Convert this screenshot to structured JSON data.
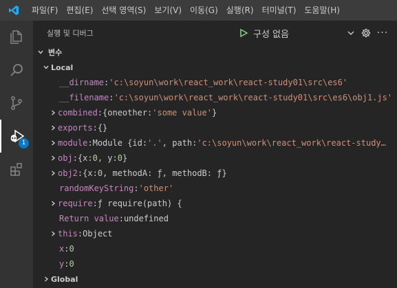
{
  "menu": [
    "파일(F)",
    "편집(E)",
    "선택 영역(S)",
    "보기(V)",
    "이동(G)",
    "실행(R)",
    "터미널(T)",
    "도움말(H)"
  ],
  "activity_badge": "1",
  "sidebar": {
    "title": "실행 및 디버그",
    "config_label": "구성 없음",
    "more_label": "···",
    "section_title": "변수"
  },
  "variables": {
    "local_scope": "Local",
    "global_scope": "Global",
    "dirname": {
      "name": "__dirname",
      "value": "'c:\\soyun\\work\\react_work\\react-study01\\src\\es6'"
    },
    "filename": {
      "name": "__filename",
      "value": "'c:\\soyun\\work\\react_work\\react-study01\\src\\es6\\obj1.js'"
    },
    "combined": {
      "name": "combined",
      "value_a": "{oneother: ",
      "value_b": "'some value'",
      "value_c": "}"
    },
    "exports": {
      "name": "exports",
      "value": "{}"
    },
    "module": {
      "name": "module",
      "value_a": "Module {id: ",
      "value_b": "'.'",
      "value_c": ", path: ",
      "value_d": "'c:\\soyun\\work\\react_work\\react-study…"
    },
    "obj": {
      "name": "obj",
      "value_a": "{x: ",
      "value_b": "0",
      "value_c": ", y: ",
      "value_d": "0",
      "value_e": "}"
    },
    "obj2": {
      "name": "obj2",
      "value_a": "{x: ",
      "value_b": "0",
      "value_c": ", methodA: ƒ, methodB: ƒ}"
    },
    "randomKeyString": {
      "name": "randomKeyString",
      "value": "'other'"
    },
    "require": {
      "name": "require",
      "value": "ƒ require(path) {"
    },
    "return_value": {
      "name": "Return value",
      "value": "undefined"
    },
    "this": {
      "name": "this",
      "value": "Object"
    },
    "x": {
      "name": "x",
      "value": "0"
    },
    "y": {
      "name": "y",
      "value": "0"
    },
    "separator": ": "
  },
  "colors": {
    "accent": "#007acc",
    "variable_name": "#c586c0",
    "string": "#ce9178",
    "number": "#b5cea8",
    "play": "#89d185"
  }
}
